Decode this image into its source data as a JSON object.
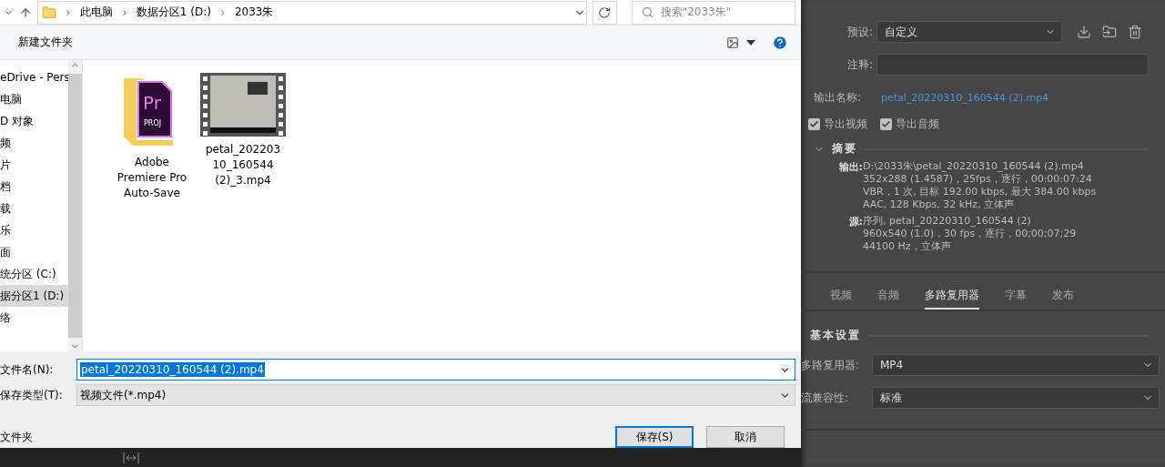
{
  "dialog": {
    "breadcrumbs": [
      "此电脑",
      "数据分区1 (D:)",
      "2033朱"
    ],
    "search": {
      "placeholder": "搜索\"2033朱\""
    },
    "toolbar": {
      "new_folder": "新建文件夹"
    },
    "nav_items": [
      {
        "label": "eDrive - Pers",
        "selected": false
      },
      {
        "label": "电脑",
        "selected": false
      },
      {
        "label": "D 对象",
        "selected": false
      },
      {
        "label": "频",
        "selected": false
      },
      {
        "label": "片",
        "selected": false
      },
      {
        "label": "档",
        "selected": false
      },
      {
        "label": "载",
        "selected": false
      },
      {
        "label": "乐",
        "selected": false
      },
      {
        "label": "面",
        "selected": false
      },
      {
        "label": "统分区 (C:)",
        "selected": false
      },
      {
        "label": "据分区1 (D:)",
        "selected": true
      },
      {
        "label": "络",
        "selected": false
      }
    ],
    "files": [
      {
        "kind": "project-folder",
        "name": "Adobe Premiere Pro Auto-Save",
        "icon_text": [
          "Pr",
          "PROJ"
        ]
      },
      {
        "kind": "video",
        "name": "petal_20220310_160544 (2)_3.mp4"
      }
    ],
    "filename": {
      "label": "文件名(N):",
      "value": "petal_20220310_160544 (2).mp4"
    },
    "filetype": {
      "label": "保存类型(T):",
      "value": "视频文件(*.mp4)"
    },
    "hide_folders": "文件夹",
    "buttons": [
      {
        "label": "保存(S)",
        "primary": true
      },
      {
        "label": "取消",
        "primary": false
      }
    ]
  },
  "export": {
    "preset": {
      "label": "预设:",
      "value": "自定义"
    },
    "comment": {
      "label": "注释:"
    },
    "output_name": {
      "label": "输出名称:",
      "value": "petal_20220310_160544 (2).mp4"
    },
    "checks": [
      {
        "label": "导出视频",
        "checked": true
      },
      {
        "label": "导出音频",
        "checked": true
      }
    ],
    "summary": {
      "title": "摘要",
      "groups": [
        {
          "label": "输出:",
          "lines": [
            "D:\\2033朱\\petal_20220310_160544 (2).mp4",
            "352x288 (1.4587)，25fps，逐行，00:00:07:24",
            "VBR，1 次, 目标 192.00 kbps, 最大 384.00 kbps",
            "AAC, 128 Kbps, 32  kHz, 立体声"
          ]
        },
        {
          "label": "源:",
          "lines": [
            "序列, petal_20220310_160544 (2)",
            "960x540 (1.0)，30 fps，逐行，00;00;07;29",
            "44100 Hz，立体声"
          ]
        }
      ]
    },
    "tabs": [
      {
        "label": "视频",
        "selected": false
      },
      {
        "label": "音频",
        "selected": false
      },
      {
        "label": "多路复用器",
        "selected": true
      },
      {
        "label": "字幕",
        "selected": false
      },
      {
        "label": "发布",
        "selected": false
      }
    ],
    "basic": {
      "title": "基本设置",
      "fields": [
        {
          "label": "多路复用器:",
          "value": "MP4"
        },
        {
          "label": "流兼容性:",
          "value": "标准"
        }
      ]
    }
  }
}
